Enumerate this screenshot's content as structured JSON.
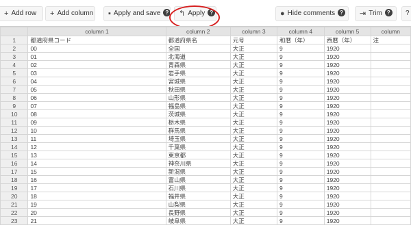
{
  "toolbar": {
    "add_row": "Add row",
    "add_column": "Add column",
    "apply_and_save": "Apply and save",
    "apply": "Apply",
    "hide_comments": "Hide comments",
    "trim": "Trim",
    "help": "?"
  },
  "icons": {
    "plus": "+",
    "save": "▪",
    "undo": "↰",
    "comment": "●",
    "trim": "⇥"
  },
  "colors": {
    "highlight_circle": "#d61f1f"
  },
  "table": {
    "columns": [
      "column 1",
      "column 2",
      "column 3",
      "column 4",
      "column 5",
      "column"
    ],
    "rows": [
      [
        "1",
        "都道府県コード",
        "都道府県名",
        "元号",
        "和暦（年）",
        "西暦（年）",
        "注"
      ],
      [
        "2",
        "00",
        "全国",
        "大正",
        "9",
        "1920",
        ""
      ],
      [
        "3",
        "01",
        "北海道",
        "大正",
        "9",
        "1920",
        ""
      ],
      [
        "4",
        "02",
        "青森県",
        "大正",
        "9",
        "1920",
        ""
      ],
      [
        "5",
        "03",
        "岩手県",
        "大正",
        "9",
        "1920",
        ""
      ],
      [
        "6",
        "04",
        "宮城県",
        "大正",
        "9",
        "1920",
        ""
      ],
      [
        "7",
        "05",
        "秋田県",
        "大正",
        "9",
        "1920",
        ""
      ],
      [
        "8",
        "06",
        "山形県",
        "大正",
        "9",
        "1920",
        ""
      ],
      [
        "9",
        "07",
        "福島県",
        "大正",
        "9",
        "1920",
        ""
      ],
      [
        "10",
        "08",
        "茨城県",
        "大正",
        "9",
        "1920",
        ""
      ],
      [
        "11",
        "09",
        "栃木県",
        "大正",
        "9",
        "1920",
        ""
      ],
      [
        "12",
        "10",
        "群馬県",
        "大正",
        "9",
        "1920",
        ""
      ],
      [
        "13",
        "11",
        "埼玉県",
        "大正",
        "9",
        "1920",
        ""
      ],
      [
        "14",
        "12",
        "千葉県",
        "大正",
        "9",
        "1920",
        ""
      ],
      [
        "15",
        "13",
        "東京都",
        "大正",
        "9",
        "1920",
        ""
      ],
      [
        "16",
        "14",
        "神奈川県",
        "大正",
        "9",
        "1920",
        ""
      ],
      [
        "17",
        "15",
        "新潟県",
        "大正",
        "9",
        "1920",
        ""
      ],
      [
        "18",
        "16",
        "富山県",
        "大正",
        "9",
        "1920",
        ""
      ],
      [
        "19",
        "17",
        "石川県",
        "大正",
        "9",
        "1920",
        ""
      ],
      [
        "20",
        "18",
        "福井県",
        "大正",
        "9",
        "1920",
        ""
      ],
      [
        "21",
        "19",
        "山梨県",
        "大正",
        "9",
        "1920",
        ""
      ],
      [
        "22",
        "20",
        "長野県",
        "大正",
        "9",
        "1920",
        ""
      ],
      [
        "23",
        "21",
        "岐阜県",
        "大正",
        "9",
        "1920",
        ""
      ]
    ]
  }
}
